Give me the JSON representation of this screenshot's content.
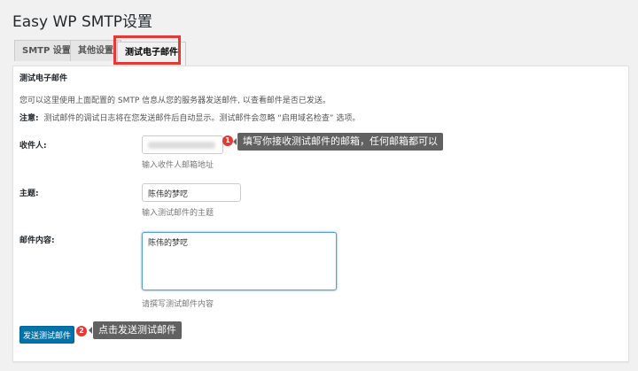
{
  "page_title": "Easy WP SMTP设置",
  "tabs": [
    {
      "label": "SMTP 设置"
    },
    {
      "label": "其他设置"
    },
    {
      "label": "测试电子邮件"
    }
  ],
  "section": {
    "heading": "测试电子邮件",
    "intro": "您可以这里使用上面配置的 SMTP 信息从您的服务器发送邮件, 以查看邮件是否已发送。",
    "note_label": "注意:",
    "note": "测试邮件的调试日志将在您发送邮件后自动显示。测试邮件会忽略 “启用域名检查” 选项。"
  },
  "form": {
    "recipient": {
      "label": "收件人:",
      "value": "",
      "help": "输入收件人邮箱地址"
    },
    "subject": {
      "label": "主题:",
      "value": "陈伟的梦呓",
      "help": "输入测试邮件的主题"
    },
    "body": {
      "label": "邮件内容:",
      "value": "陈伟的梦呓",
      "help": "请撰写测试邮件内容"
    },
    "send_label": "发送测试邮件"
  },
  "annotations": [
    {
      "number": "1",
      "text": "填写你接收测试邮件的邮箱，任何邮箱都可以"
    },
    {
      "number": "2",
      "text": "点击发送测试邮件"
    }
  ],
  "colors": {
    "highlight": "#e53935",
    "primary": "#0073aa",
    "tooltip": "#616161"
  }
}
